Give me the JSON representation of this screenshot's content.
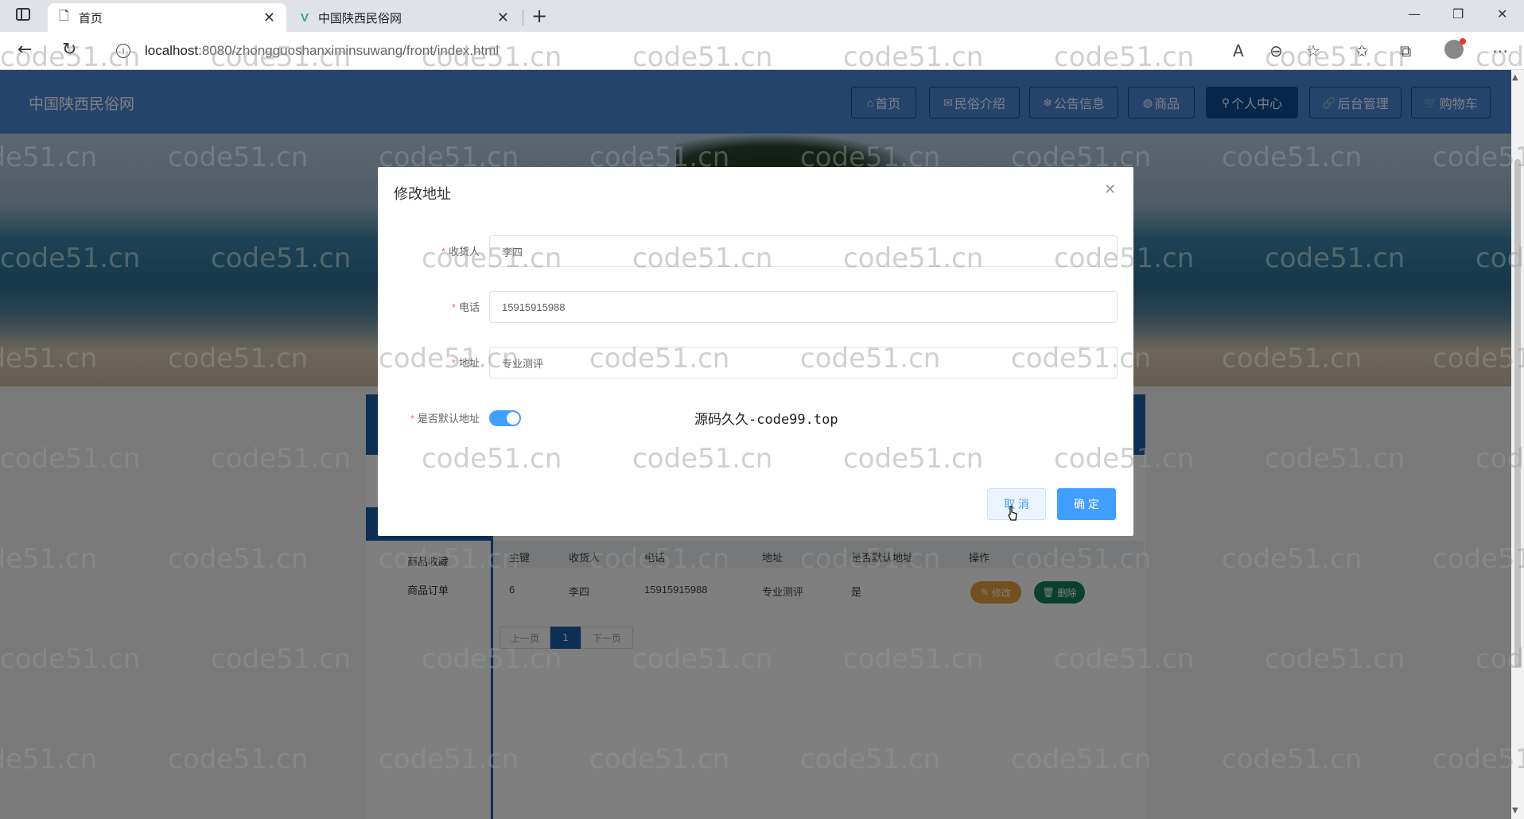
{
  "browser": {
    "tabs": [
      {
        "title": "首页",
        "active": true
      },
      {
        "title": "中国陕西民俗网",
        "active": false
      }
    ],
    "url_host": "localhost",
    "url_rest": ":8080/zhongguoshanximinsuwang/front/index.html"
  },
  "site": {
    "title": "中国陕西民俗网",
    "nav": [
      {
        "label": "首页",
        "icon": "home-icon"
      },
      {
        "label": "民俗介绍",
        "icon": "mail-icon"
      },
      {
        "label": "公告信息",
        "icon": "snowflake-icon"
      },
      {
        "label": "商品",
        "icon": "globe-icon"
      },
      {
        "label": "个人中心",
        "icon": "user-icon",
        "active": true
      },
      {
        "label": "后台管理",
        "icon": "link-icon"
      },
      {
        "label": "购物车",
        "icon": "cart-icon"
      }
    ]
  },
  "sidebar": {
    "items": [
      "商品收藏",
      "商品订单"
    ]
  },
  "table": {
    "headers": [
      "主键",
      "收货人",
      "电话",
      "地址",
      "是否默认地址",
      "操作"
    ],
    "rows": [
      {
        "id": "6",
        "name": "李四",
        "phone": "15915915988",
        "address": "专业测评",
        "default": "是"
      }
    ],
    "edit_label": "修改",
    "delete_label": "删除"
  },
  "pagination": {
    "prev": "上一页",
    "current": "1",
    "next": "下一页"
  },
  "dialog": {
    "title": "修改地址",
    "fields": {
      "name_label": "收货人",
      "name_value": "李四",
      "phone_label": "电话",
      "phone_value": "15915915988",
      "address_label": "地址",
      "address_value": "专业测评",
      "default_label": "是否默认地址",
      "default_on": true
    },
    "note": "源码久久-code99.top",
    "cancel": "取 消",
    "confirm": "确 定"
  },
  "watermark": "code51.cn",
  "colors": {
    "header": "#4a88d8",
    "nav_border": "#0d4f9a",
    "primary": "#409eff",
    "accent": "#1d5fa8",
    "edit": "#e6a23c",
    "delete": "#13805c"
  }
}
